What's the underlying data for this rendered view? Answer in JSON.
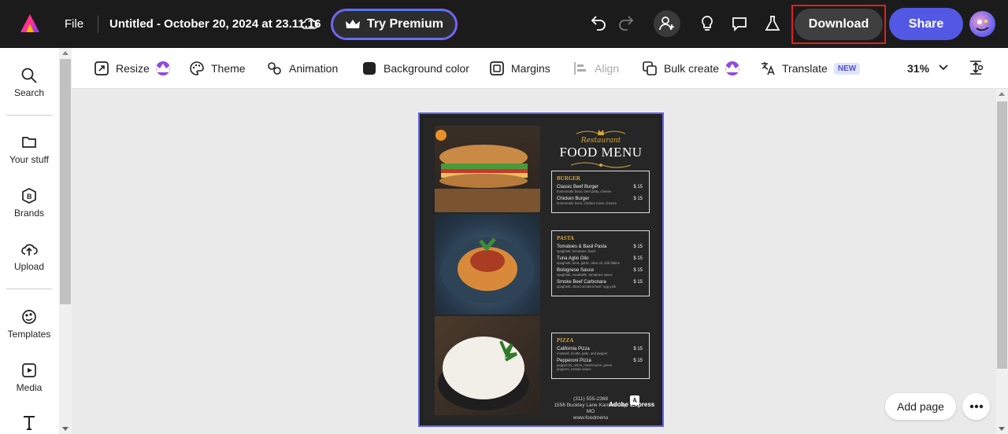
{
  "topbar": {
    "file_label": "File",
    "doc_title": "Untitled - October 20, 2024 at 23.11.16",
    "premium_label": "Try Premium",
    "download_label": "Download",
    "share_label": "Share"
  },
  "sidebar": {
    "items": [
      {
        "label": "Search",
        "icon": "search-icon"
      },
      {
        "label": "Your stuff",
        "icon": "folder-icon"
      },
      {
        "label": "Brands",
        "icon": "brand-icon"
      },
      {
        "label": "Upload",
        "icon": "upload-icon"
      },
      {
        "label": "Templates",
        "icon": "templates-icon"
      },
      {
        "label": "Media",
        "icon": "media-icon"
      },
      {
        "label": "",
        "icon": "text-icon"
      }
    ]
  },
  "toolbar": {
    "resize": "Resize",
    "theme": "Theme",
    "animation": "Animation",
    "background_color": "Background color",
    "margins": "Margins",
    "align": "Align",
    "bulk_create": "Bulk create",
    "translate": "Translate",
    "new_badge": "NEW",
    "zoom": "31%"
  },
  "menu": {
    "script": "Restaurant",
    "title": "FOOD MENU",
    "sections": [
      {
        "name": "BURGER",
        "items": [
          {
            "name": "Classic Beef Burger",
            "desc": "homemade buns, beef patty, cheese",
            "price": "$ 15"
          },
          {
            "name": "Chicken Burger",
            "desc": "homemade buns, chicken meat, cheese",
            "price": "$ 15"
          }
        ]
      },
      {
        "name": "PASTA",
        "items": [
          {
            "name": "Tomatoes & Basil Pasta",
            "desc": "spaghetti, tomatoes, basil",
            "price": "$ 15"
          },
          {
            "name": "Tuna Aglio Olio",
            "desc": "spaghetti, tuna, garlic, olive oil, chili flakes",
            "price": "$ 15"
          },
          {
            "name": "Bolognese Sauce",
            "desc": "spaghetti, meatballs, tomatoes sauce",
            "price": "$ 15"
          },
          {
            "name": "Smoke Beef Carbonara",
            "desc": "spaghetti, sliced smoked beef, egg yolk",
            "price": "$ 15"
          }
        ]
      },
      {
        "name": "PIZZA",
        "items": [
          {
            "name": "California Pizza",
            "desc": "mustard, ricotta, pate, and pepper",
            "price": "$ 15"
          },
          {
            "name": "Pepperoni Pizza",
            "desc": "pepperoni, onion, mushrooms, green peppers, tomato sauce",
            "price": "$ 15"
          }
        ]
      }
    ],
    "phone": "(311) 555-2368",
    "address": "1556 Buckley Lane Kansas City, MO",
    "website": "www.foodmenu",
    "watermark": "Adobe Express"
  },
  "canvas": {
    "add_page": "Add page"
  },
  "colors": {
    "accent": "#5258e4",
    "premium": "#8e4be0",
    "highlight": "#e02020",
    "gold": "#d4a73a"
  }
}
